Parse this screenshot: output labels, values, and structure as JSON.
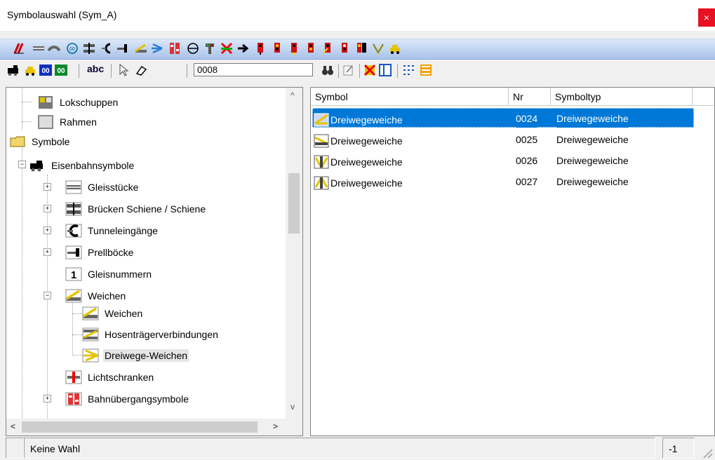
{
  "window": {
    "title": "Symbolauswahl (Sym_A)",
    "close_glyph": "×"
  },
  "toolbar2": {
    "abc_label": "abc",
    "id_value": "0008"
  },
  "tree": {
    "items": [
      {
        "label": "Lokschuppen",
        "icon": "depot-icon"
      },
      {
        "label": "Rahmen",
        "icon": "frame-icon"
      },
      {
        "label": "Symbole",
        "icon": "folder-icon"
      },
      {
        "label": "Eisenbahnsymbole",
        "icon": "locomotive-icon"
      },
      {
        "label": "Gleisstücke",
        "icon": "track-icon"
      },
      {
        "label": "Brücken Schiene / Schiene",
        "icon": "bridge-icon"
      },
      {
        "label": "Tunneleingänge",
        "icon": "tunnel-icon"
      },
      {
        "label": "Prellböcke",
        "icon": "buffer-stop-icon"
      },
      {
        "label": "Gleisnummern",
        "icon": "track-number-icon"
      },
      {
        "label": "Weichen",
        "icon": "switch-icon"
      },
      {
        "label": "Weichen",
        "icon": "switch-icon"
      },
      {
        "label": "Hosenträgerverbindungen",
        "icon": "scissors-crossing-icon"
      },
      {
        "label": "Dreiwege-Weichen",
        "icon": "three-way-switch-icon"
      },
      {
        "label": "Lichtschranken",
        "icon": "light-barrier-icon"
      },
      {
        "label": "Bahnübergangsymbole",
        "icon": "level-crossing-icon"
      }
    ]
  },
  "list": {
    "columns": [
      "Symbol",
      "Nr",
      "Symboltyp"
    ],
    "rows": [
      {
        "symbol": "Dreiwegeweiche",
        "nr": "0024",
        "type": "Dreiwegeweiche",
        "selected": true
      },
      {
        "symbol": "Dreiwegeweiche",
        "nr": "0025",
        "type": "Dreiwegeweiche",
        "selected": false
      },
      {
        "symbol": "Dreiwegeweiche",
        "nr": "0026",
        "type": "Dreiwegeweiche",
        "selected": false
      },
      {
        "symbol": "Dreiwegeweiche",
        "nr": "0027",
        "type": "Dreiwegeweiche",
        "selected": false
      }
    ]
  },
  "status": {
    "text": "Keine Wahl",
    "value": "-1"
  },
  "colors": {
    "selection": "#0078d7",
    "close": "#e81123",
    "toolbar_top": "#dbe8f9",
    "toolbar_bottom": "#a9c3ea"
  }
}
